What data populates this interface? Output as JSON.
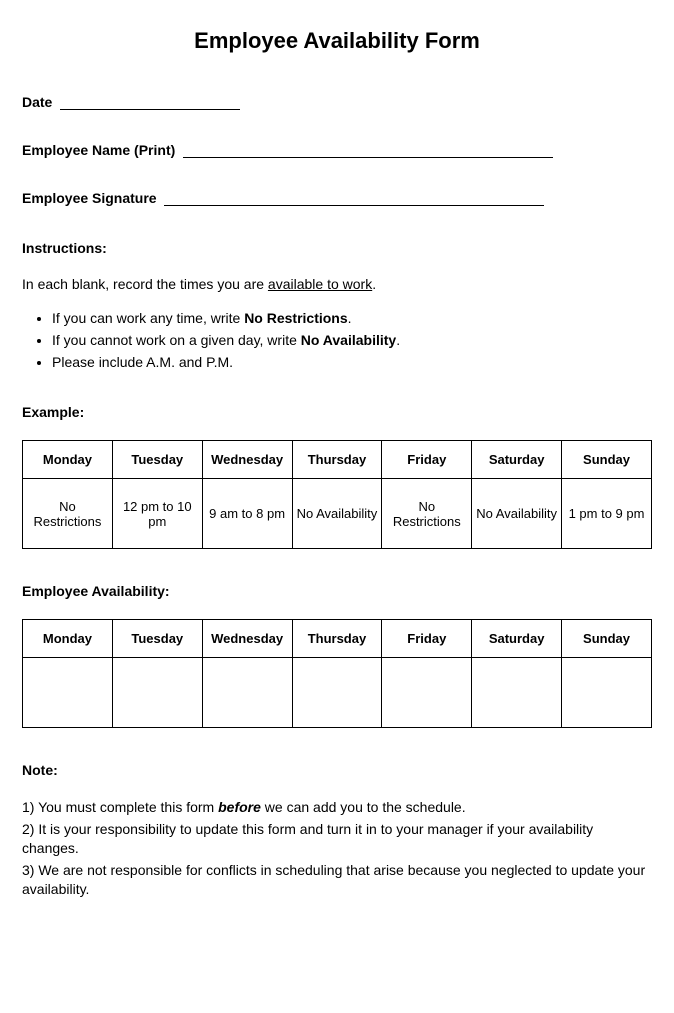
{
  "title": "Employee Availability Form",
  "fields": {
    "date_label": "Date",
    "name_label": "Employee Name (Print)",
    "signature_label": "Employee Signature"
  },
  "instructions": {
    "heading": "Instructions:",
    "intro_prefix": "In each blank, record the times you are ",
    "intro_underlined": "available to work",
    "intro_suffix": ".",
    "bullets": [
      {
        "prefix": "If you can work any time, write ",
        "bold": "No Restrictions",
        "suffix": "."
      },
      {
        "prefix": "If you cannot work on a given day, write ",
        "bold": "No Availability",
        "suffix": "."
      },
      {
        "prefix": "Please include A.M. and P.M.",
        "bold": "",
        "suffix": ""
      }
    ]
  },
  "example": {
    "heading": "Example:",
    "days": [
      "Monday",
      "Tuesday",
      "Wednesday",
      "Thursday",
      "Friday",
      "Saturday",
      "Sunday"
    ],
    "values": [
      "No Restrictions",
      "12 pm to 10 pm",
      "9 am to 8 pm",
      "No Availability",
      "No Restrictions",
      "No Availability",
      "1 pm to 9 pm"
    ]
  },
  "availability": {
    "heading": "Employee Availability:",
    "days": [
      "Monday",
      "Tuesday",
      "Wednesday",
      "Thursday",
      "Friday",
      "Saturday",
      "Sunday"
    ],
    "values": [
      "",
      "",
      "",
      "",
      "",
      "",
      ""
    ]
  },
  "note": {
    "heading": "Note:",
    "items": [
      {
        "num": "1) ",
        "prefix": "You must complete this form ",
        "emph": "before",
        "suffix": " we can add you to the schedule."
      },
      {
        "num": "2) ",
        "prefix": "It is your responsibility to update this form and turn it in to your manager if your availability changes.",
        "emph": "",
        "suffix": ""
      },
      {
        "num": "3) ",
        "prefix": "We are not responsible for conflicts in scheduling that arise because you neglected to update your availability.",
        "emph": "",
        "suffix": ""
      }
    ]
  }
}
